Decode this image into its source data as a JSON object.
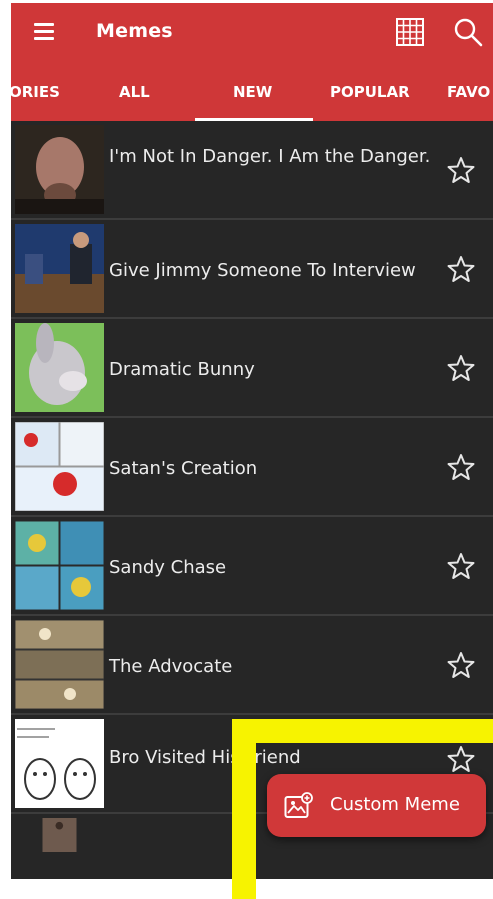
{
  "app": {
    "title": "Memes"
  },
  "tabs": [
    {
      "label": "ORIES"
    },
    {
      "label": "ALL"
    },
    {
      "label": "NEW"
    },
    {
      "label": "POPULAR"
    },
    {
      "label": "FAVO"
    }
  ],
  "memes": [
    {
      "title": "I'm Not In Danger. I Am the Danger."
    },
    {
      "title": "Give Jimmy Someone To Interview"
    },
    {
      "title": "Dramatic Bunny"
    },
    {
      "title": "Satan's Creation"
    },
    {
      "title": "Sandy Chase"
    },
    {
      "title": "The Advocate"
    },
    {
      "title": "Bro Visited His Friend"
    }
  ],
  "fab": {
    "label": "Custom Meme"
  },
  "colors": {
    "accent": "#cf3738",
    "background": "#262626",
    "highlight": "#f7f300"
  },
  "icons": [
    "menu-icon",
    "grid-icon",
    "search-icon",
    "star-icon",
    "image-add-icon"
  ]
}
